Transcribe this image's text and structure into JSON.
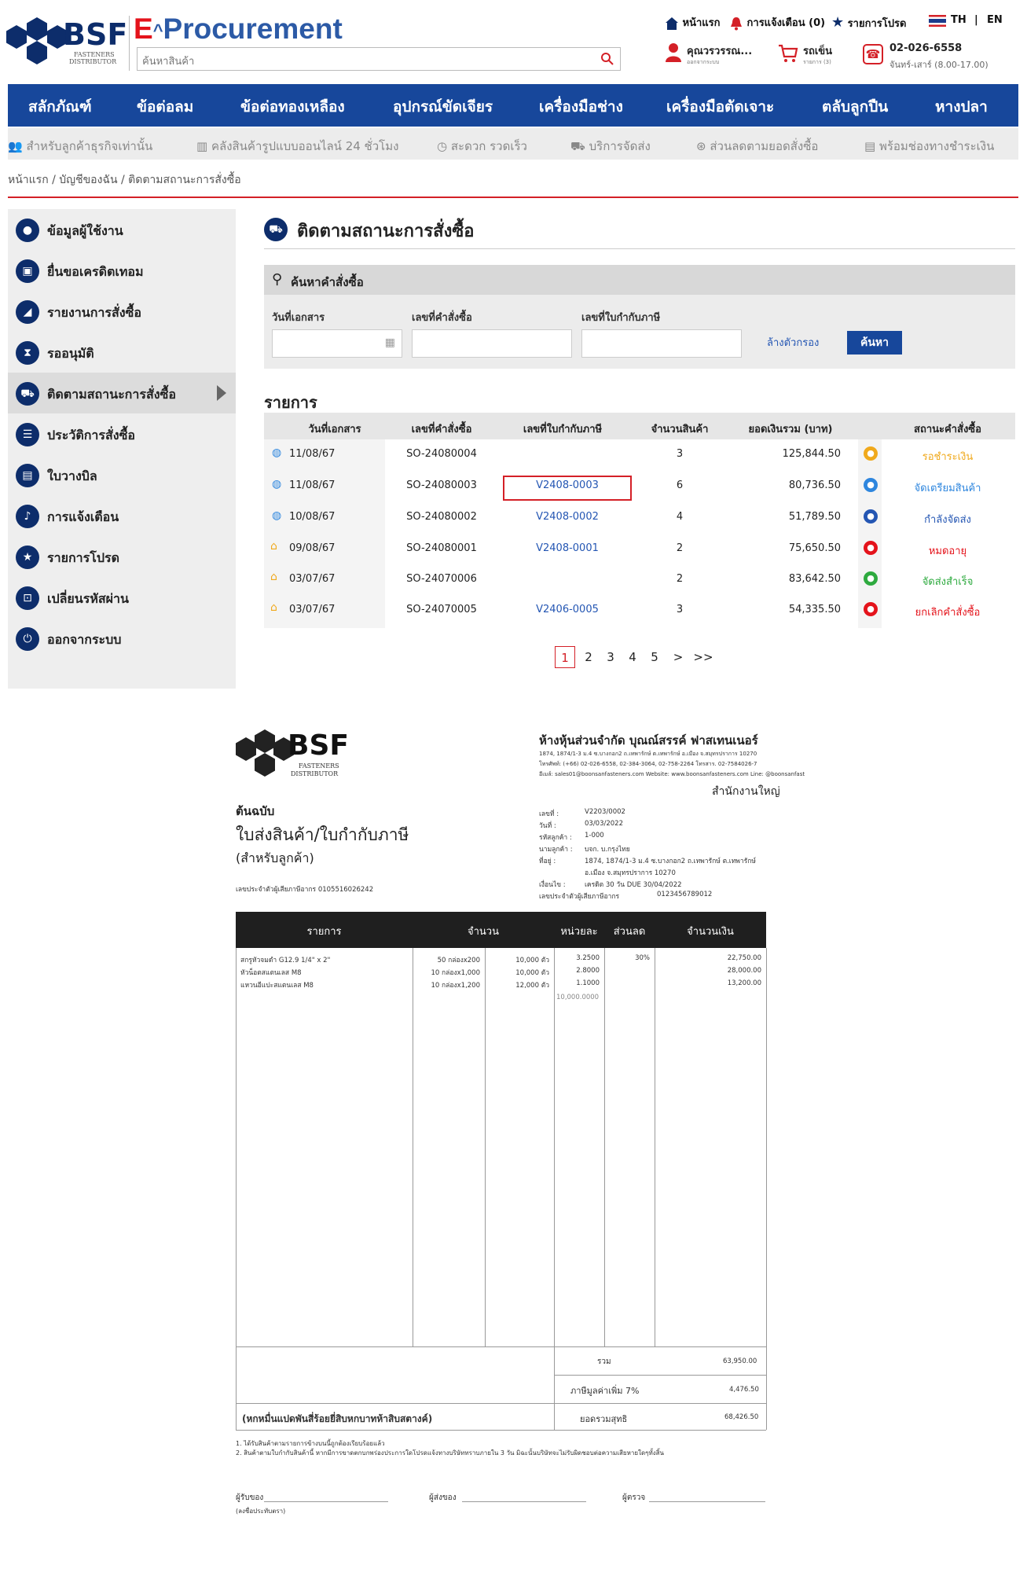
{
  "header": {
    "logo": {
      "brand": "BSF",
      "sub1": "FASTENERS",
      "sub2": "DISTRIBUTOR"
    },
    "eproc_prefix": "E",
    "eproc_title": "Procurement",
    "search_placeholder": "ค้นหาสินค้า",
    "top_links": {
      "home": "หน้าแรก",
      "notifications": "การแจ้งเตือน (0)",
      "favorites": "รายการโปรด",
      "lang_th": "TH",
      "lang_sep": "|",
      "lang_en": "EN"
    },
    "account": {
      "name": "คุณวรวรรณ...",
      "sub": "ออกจากระบบ"
    },
    "cart": {
      "label": "รถเข็น",
      "sub": "รายการ (3)"
    },
    "phone": {
      "number": "02-026-6558",
      "hours": "จันทร์-เสาร์ (8.00-17.00)"
    }
  },
  "nav": {
    "items": [
      "สลักภัณฑ์",
      "ข้อต่อลม",
      "ข้อต่อทองเหลือง",
      "อุปกรณ์ขัดเจียร",
      "เครื่องมือช่าง",
      "เครื่องมือตัดเจาะ",
      "ตลับลูกปืน",
      "หางปลา"
    ]
  },
  "subnav": {
    "items": [
      "สำหรับลูกค้าธุรกิจเท่านั้น",
      "คลังสินค้ารูปแบบออนไลน์ 24 ชั่วโมง",
      "สะดวก รวดเร็ว",
      "บริการจัดส่ง",
      "ส่วนลดตามยอดสั่งซื้อ",
      "พร้อมช่องทางชำระเงิน"
    ]
  },
  "breadcrumb": "หน้าแรก / บัญชีของฉัน / ติดตามสถานะการสั่งซื้อ",
  "sidebar": {
    "items": [
      {
        "label": "ข้อมูลผู้ใช้งาน",
        "icon": "user-icon"
      },
      {
        "label": "ยื่นขอเครดิตเทอม",
        "icon": "credit-icon"
      },
      {
        "label": "รายงานการสั่งซื้อ",
        "icon": "report-icon"
      },
      {
        "label": "รออนุมัติ",
        "icon": "pending-icon"
      },
      {
        "label": "ติดตามสถานะการสั่งซื้อ",
        "icon": "truck-icon"
      },
      {
        "label": "ประวัติการสั่งซื้อ",
        "icon": "history-icon"
      },
      {
        "label": "ใบวางบิล",
        "icon": "bill-icon"
      },
      {
        "label": "การแจ้งเตือน",
        "icon": "bell-icon"
      },
      {
        "label": "รายการโปรด",
        "icon": "star-icon"
      },
      {
        "label": "เปลี่ยนรหัสผ่าน",
        "icon": "lock-icon"
      },
      {
        "label": "ออกจากระบบ",
        "icon": "logout-icon"
      }
    ]
  },
  "main": {
    "title": "ติดตามสถานะการสั่งซื้อ",
    "search": {
      "title": "ค้นหาคำสั่งซื้อ",
      "date_label": "วันที่เอกสาร",
      "order_label": "เลขที่คำสั่งซื้อ",
      "tax_label": "เลขที่ใบกำกับภาษี",
      "clear_label": "ล้างตัวกรอง",
      "search_label": "ค้นหา"
    },
    "list_title": "รายการ",
    "columns": [
      "วันที่เอกสาร",
      "เลขที่คำสั่งซื้อ",
      "เลขที่ใบกำกับภาษี",
      "จำนวนสินค้า",
      "ยอดเงินรวม (บาท)",
      "สถานะคำสั่งซื้อ"
    ],
    "rows": [
      {
        "date": "11/08/67",
        "order": "SO-24080004",
        "tax": "",
        "qty": "3",
        "total": "125,844.50",
        "status": "รอชำระเงิน",
        "status_color": "#f0a91c",
        "src": "globe-icon"
      },
      {
        "date": "11/08/67",
        "order": "SO-24080003",
        "tax": "V2408-0003",
        "qty": "6",
        "total": "80,736.50",
        "status": "จัดเตรียมสินค้า",
        "status_color": "#2e86de",
        "src": "globe-icon"
      },
      {
        "date": "10/08/67",
        "order": "SO-24080002",
        "tax": "V2408-0002",
        "qty": "4",
        "total": "51,789.50",
        "status": "กำลังจัดส่ง",
        "status_color": "#2456b3",
        "src": "globe-icon"
      },
      {
        "date": "09/08/67",
        "order": "SO-24080001",
        "tax": "V2408-0001",
        "qty": "2",
        "total": "75,650.50",
        "status": "หมดอายุ",
        "status_color": "#e4131b",
        "src": "store-icon"
      },
      {
        "date": "03/07/67",
        "order": "SO-24070006",
        "tax": "",
        "qty": "2",
        "total": "83,642.50",
        "status": "จัดส่งสำเร็จ",
        "status_color": "#2eaa3f",
        "src": "store-icon"
      },
      {
        "date": "03/07/67",
        "order": "SO-24070005",
        "tax": "V2406-0005",
        "qty": "3",
        "total": "54,335.50",
        "status": "ยกเลิกคำสั่งซื้อ",
        "status_color": "#e4131b",
        "src": "store-icon"
      }
    ],
    "pagination": [
      "1",
      "2",
      "3",
      "4",
      "5",
      ">",
      ">>"
    ]
  },
  "invoice": {
    "company": "ห้างหุ้นส่วนจำกัด บุณณ์สรรค์ ฟาสเทนเนอร์",
    "addr1": "1874, 1874/1-3 ม.4 ซ.บางกอก2 ถ.เทพารักษ์ ต.เทพารักษ์ อ.เมือง จ.สมุทรปราการ 10270",
    "addr2": "โทรศัพท์: (+66) 02-026-6558, 02-384-3064, 02-758-2264 โทรสาร. 02-7584026-7",
    "addr3": "อีเมล์: sales01@boonsanfasteners.com Website: www.boonsanfasteners.com Line: @boonsanfast",
    "branch": "สำนักงานใหญ่",
    "original": "ต้นฉบับ",
    "doc_title": "ใบส่งสินค้า/ใบกำกับภาษี",
    "doc_sub": "(สำหรับลูกค้า)",
    "seller_tax": "เลขประจำตัวผู้เสียภาษีอากร 0105516026242",
    "meta": [
      {
        "k": "เลขที่ :",
        "v": "V2203/0002"
      },
      {
        "k": "วันที่ :",
        "v": "03/03/2022"
      },
      {
        "k": "รหัสลูกค้า :",
        "v": "1-000"
      },
      {
        "k": "นามลูกค้า :",
        "v": "บจก. บ.กรุงไทย"
      },
      {
        "k": "ที่อยู่ :",
        "v": "1874, 1874/1-3 ม.4 ซ.บางกอก2 ถ.เทพารักษ์ ต.เทพารักษ์"
      },
      {
        "k": "",
        "v": "อ.เมือง จ.สมุทรปราการ 10270"
      },
      {
        "k": "เงื่อนไข :",
        "v": "เครดิต 30 วัน DUE 30/04/2022"
      },
      {
        "k": "เลขประจำตัวผู้เสียภาษีอากร",
        "v": "0123456789012"
      }
    ],
    "columns": [
      "รายการ",
      "จำนวน",
      "หน่วยละ",
      "ส่วนลด",
      "จำนวนเงิน"
    ],
    "items": [
      {
        "name": "สกรูหัวจมดำ G12.9 1/4\" x 2\"",
        "pack": "50 กล่องx200",
        "qty": "10,000 ตัว",
        "price": "3.2500",
        "disc": "30%",
        "amount": "22,750.00"
      },
      {
        "name": "หัวน็อตสแตนเลส M8",
        "pack": "10 กล่องx1,000",
        "qty": "10,000 ตัว",
        "price": "2.8000",
        "disc": "",
        "amount": "28,000.00"
      },
      {
        "name": "แหวนอีแปะสแตนเลส M8",
        "pack": "10 กล่องx1,200",
        "qty": "12,000 ตัว",
        "price": "1.1000",
        "disc": "",
        "amount": "13,200.00"
      }
    ],
    "extra_price": "10,000.0000",
    "summary": {
      "subtotal_label": "รวม",
      "subtotal": "63,950.00",
      "vat_label": "ภาษีมูลค่าเพิ่ม 7%",
      "vat": "4,476.50",
      "net_label": "ยอดรวมสุทธิ",
      "net": "68,426.50",
      "text_amount": "(หกหมื่นแปดพันสี่ร้อยยี่สิบหกบาทห้าสิบสตางค์)"
    },
    "notes": [
      "1.  ได้รับสินค้าตามรายการข้างบนนี้ถูกต้องเรียบร้อยแล้ว",
      "2.  สินค้าตามใบกำกับสินค้านี้ หากมีการขาดตกบกพร่องประการใดโปรดแจ้งทางบริษัททราบภายใน 3 วัน มิฉะนั้นบริษัทจะไม่รับผิดชอบต่อความเสียหายใดๆทั้งสิ้น"
    ],
    "sign": {
      "receiver": "ผู้รับของ",
      "receiver_sub": "(ลงชื่อประทับตรา)",
      "sender": "ผู้ส่งของ",
      "checker": "ผู้ตรวจ"
    }
  }
}
